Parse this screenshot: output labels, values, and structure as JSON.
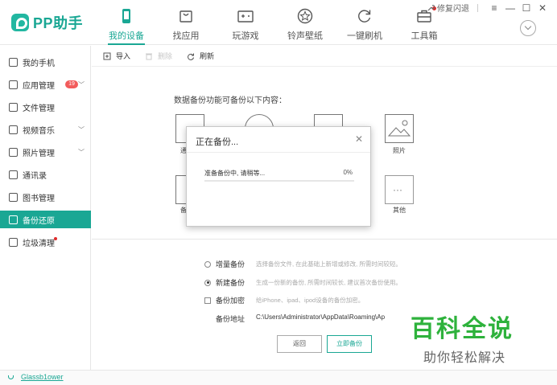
{
  "app": {
    "logo_text": "PP助手"
  },
  "nav": [
    {
      "label": "我的设备",
      "icon": "phone-icon",
      "active": true
    },
    {
      "label": "找应用",
      "icon": "shopping-bag-icon"
    },
    {
      "label": "玩游戏",
      "icon": "gamepad-icon"
    },
    {
      "label": "铃声壁纸",
      "icon": "star-icon"
    },
    {
      "label": "一键刷机",
      "icon": "refresh-icon"
    },
    {
      "label": "工具箱",
      "icon": "toolbox-icon",
      "dot": true
    }
  ],
  "window": {
    "fix_label": "修复闪退"
  },
  "sidebar": {
    "items": [
      {
        "label": "我的手机"
      },
      {
        "label": "应用管理",
        "badge": "19"
      },
      {
        "label": "文件管理"
      },
      {
        "label": "视频音乐"
      },
      {
        "label": "照片管理"
      },
      {
        "label": "通讯录"
      },
      {
        "label": "图书管理"
      },
      {
        "label": "备份还原",
        "active": true
      },
      {
        "label": "垃圾清理",
        "dot": true
      }
    ]
  },
  "toolbar": {
    "import_label": "导入",
    "delete_label": "删除",
    "refresh_label": "刷新"
  },
  "main": {
    "intro": "数据备份功能可备份以下内容：",
    "categories": {
      "c1": "通",
      "photos": "照片",
      "c5": "备",
      "other": "其他"
    },
    "options": {
      "incremental": {
        "label": "增量备份",
        "desc": "选择备份文件, 在此基础上新增或修改, 所需时间较短。"
      },
      "new": {
        "label": "新建备份",
        "desc": "生成一份新的备份, 所需时间较长, 建议首次备份使用。"
      },
      "encrypt": {
        "label": "备份加密",
        "desc": "给iPhone、ipad、ipod设备的备份加密。"
      }
    },
    "address_label": "备份地址",
    "address_value": "C:\\Users\\Administrator\\AppData\\Roaming\\Ap",
    "back_label": "返回",
    "start_label": "立即备份"
  },
  "dialog": {
    "title": "正在备份...",
    "message": "准备备份中, 请稍等...",
    "percent_text": "0%",
    "progress": 0
  },
  "footer": {
    "device_name": "Glassb1ower"
  },
  "watermark": {
    "big": "百科全说",
    "small": "助你轻松解决"
  },
  "colors": {
    "accent": "#1aa794",
    "badge": "#f25b5b",
    "watermark": "#2eb23c"
  }
}
